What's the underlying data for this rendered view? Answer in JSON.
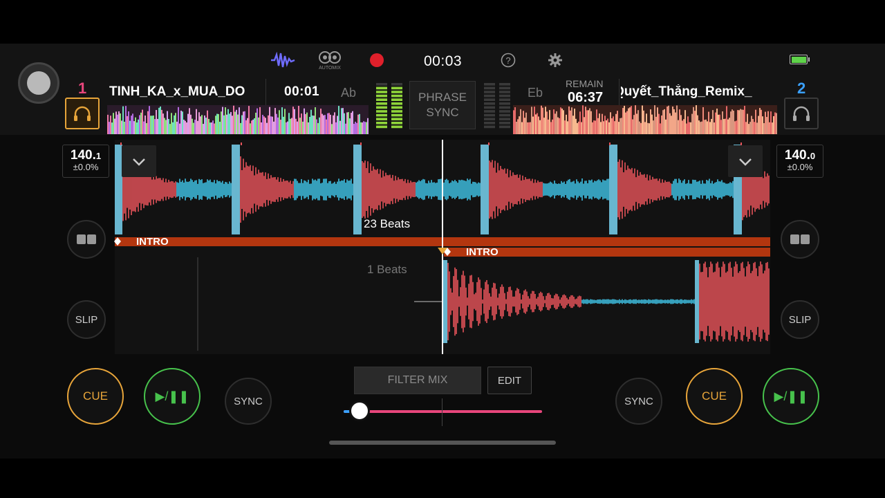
{
  "header": {
    "elapsed_time": "00:03",
    "automix_label": "AUTOMIX",
    "colors": {
      "battery": "#5fd34a",
      "record": "#e0202b",
      "waveform_icon": "#6f6cff"
    }
  },
  "deck1": {
    "number": "1",
    "title": "TINH_KA_x_MUA_DO",
    "time": "00:01",
    "key": "Ab",
    "bpm_int": "140.",
    "bpm_dec": "1",
    "pitch": "±0.0%",
    "beats_label": "23 Beats",
    "intro_label": "INTRO",
    "color": "#e8467c"
  },
  "deck2": {
    "number": "2",
    "title": "Quyết_Thắng_Remix_",
    "remain_label": "REMAIN",
    "remain_time": "06:37",
    "key": "Eb",
    "bpm_int": "140.",
    "bpm_dec": "0",
    "pitch": "±0.0%",
    "beats_label": "1 Beats",
    "intro_label": "INTRO",
    "color": "#3aa0ff"
  },
  "center": {
    "phrase_sync_line1": "PHRASE",
    "phrase_sync_line2": "SYNC",
    "filter_mix": "FILTER MIX",
    "edit": "EDIT"
  },
  "controls": {
    "cue": "CUE",
    "play": "▶/❚❚",
    "sync": "SYNC",
    "slip": "SLIP"
  }
}
